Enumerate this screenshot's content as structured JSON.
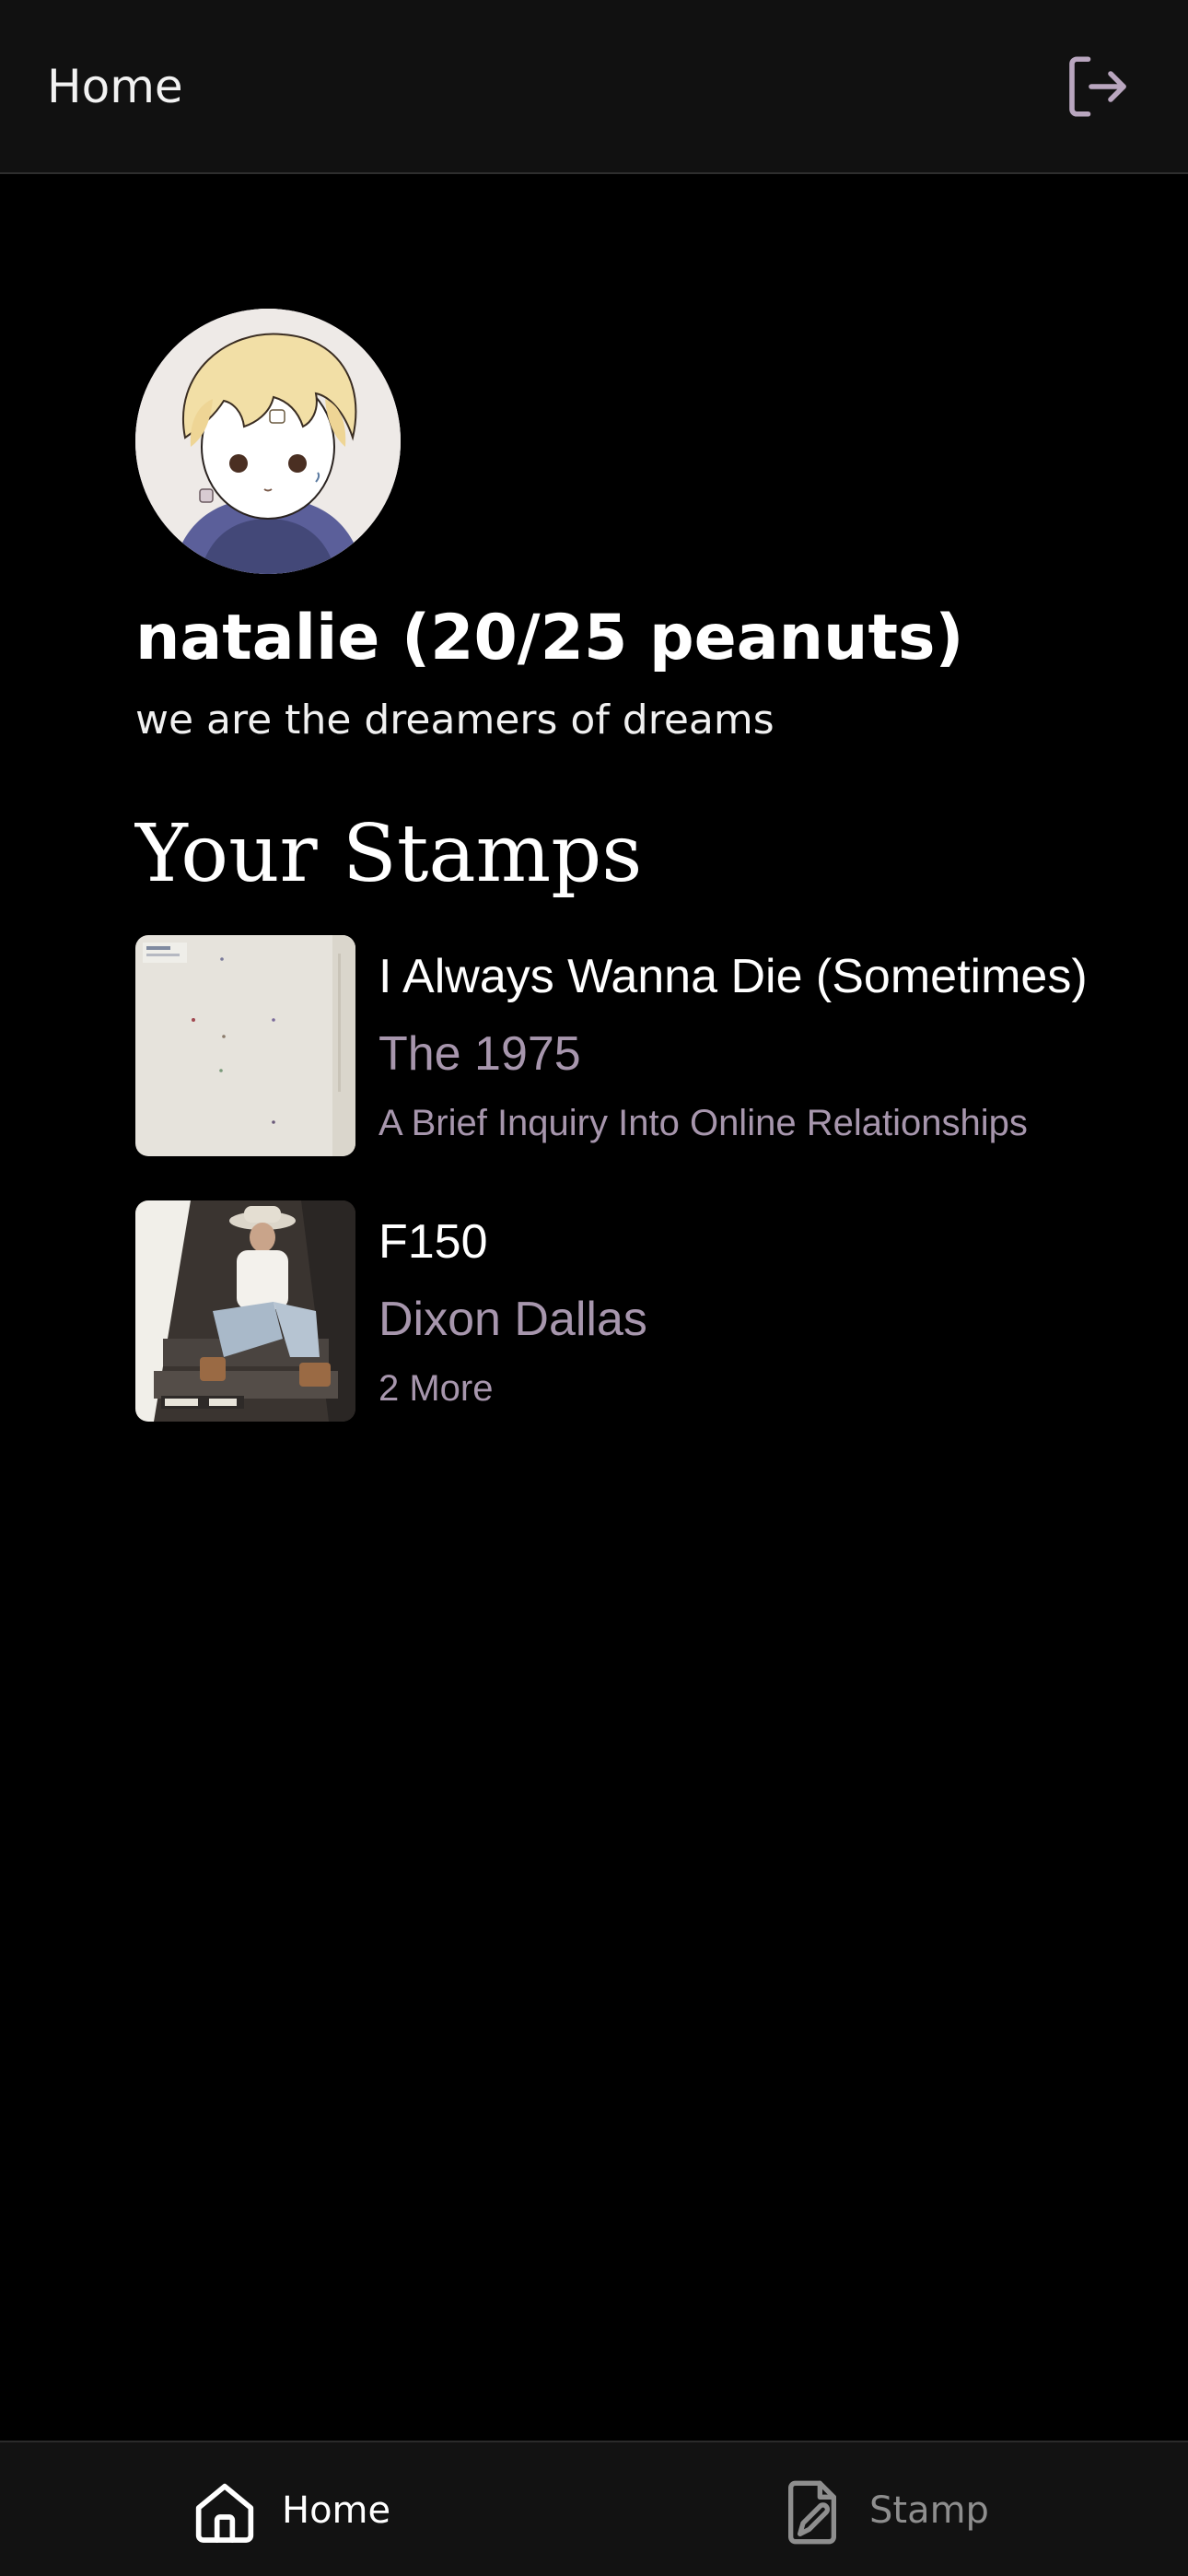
{
  "header": {
    "title": "Home",
    "logout_icon": "logout-icon"
  },
  "profile": {
    "avatar_icon": "avatar",
    "name": "natalie (20/25 peanuts)",
    "bio": "we are the dreamers of dreams"
  },
  "stamps_section": {
    "title": "Your Stamps",
    "items": [
      {
        "title": "I Always Wanna Die (Sometimes)",
        "artist": "The 1975",
        "album": "A Brief Inquiry Into Online Relationships"
      },
      {
        "title": "F150",
        "artist": "Dixon Dallas",
        "album": "2 More"
      }
    ]
  },
  "bottom_nav": {
    "items": [
      {
        "label": "Home",
        "icon": "home-icon",
        "active": true
      },
      {
        "label": "Stamp",
        "icon": "stamp-icon",
        "active": false
      }
    ]
  },
  "colors": {
    "background": "#000000",
    "bar": "#111111",
    "accent": "#a796ad",
    "inactive": "#8e8e8e"
  }
}
